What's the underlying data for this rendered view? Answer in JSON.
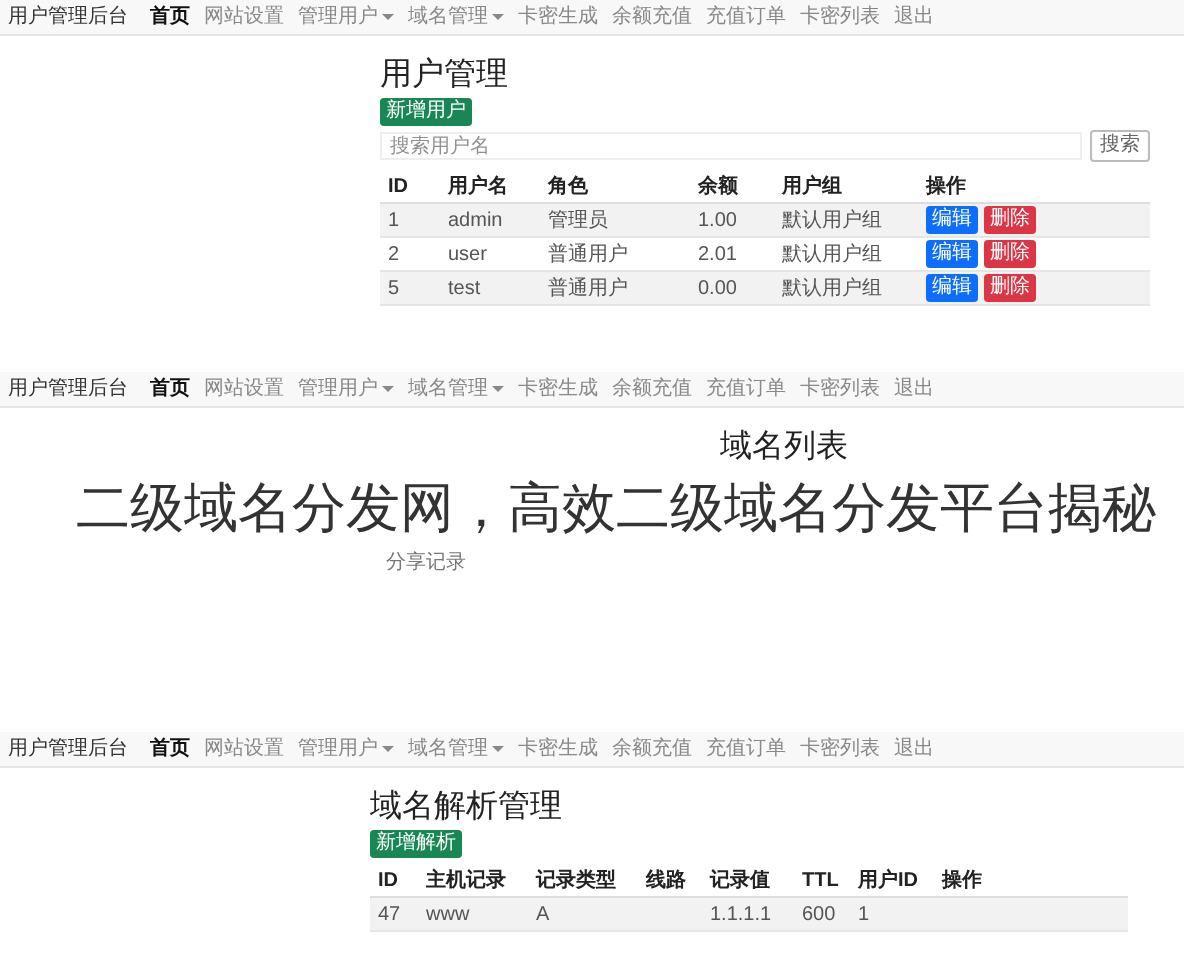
{
  "user_panel": {
    "navbar": {
      "brand": "用户管理后台",
      "items": [
        {
          "label": "首页",
          "selected": true,
          "dropdown": false
        },
        {
          "label": "网站设置",
          "selected": false,
          "dropdown": false
        },
        {
          "label": "管理用户",
          "selected": false,
          "dropdown": true
        },
        {
          "label": "域名管理",
          "selected": false,
          "dropdown": true
        },
        {
          "label": "卡密生成",
          "selected": false,
          "dropdown": false
        },
        {
          "label": "余额充值",
          "selected": false,
          "dropdown": false
        },
        {
          "label": "充值订单",
          "selected": false,
          "dropdown": false
        },
        {
          "label": "卡密列表",
          "selected": false,
          "dropdown": false
        },
        {
          "label": "退出",
          "selected": false,
          "dropdown": false
        }
      ]
    },
    "title": "用户管理",
    "add_button": "新增用户",
    "search": {
      "placeholder": "搜索用户名",
      "button": "搜索"
    },
    "table": {
      "columns": [
        "ID",
        "用户名",
        "角色",
        "余额",
        "用户组",
        "操作"
      ],
      "rows": [
        {
          "cells": [
            "1",
            "admin",
            "管理员",
            "1.00",
            "默认用户组"
          ],
          "actions": [
            {
              "kind": "edit",
              "label": "编辑"
            },
            {
              "kind": "delete",
              "label": "删除"
            }
          ]
        },
        {
          "cells": [
            "2",
            "user",
            "普通用户",
            "2.01",
            "默认用户组"
          ],
          "actions": [
            {
              "kind": "edit",
              "label": "编辑"
            },
            {
              "kind": "delete",
              "label": "删除"
            }
          ]
        },
        {
          "cells": [
            "5",
            "test",
            "普通用户",
            "0.00",
            "默认用户组"
          ],
          "actions": [
            {
              "kind": "edit",
              "label": "编辑"
            },
            {
              "kind": "delete",
              "label": "删除"
            }
          ]
        }
      ]
    }
  },
  "domain_list_panel": {
    "navbar": {
      "brand": "用户管理后台",
      "items": [
        {
          "label": "首页",
          "selected": true,
          "dropdown": false
        },
        {
          "label": "网站设置",
          "selected": false,
          "dropdown": false
        },
        {
          "label": "管理用户",
          "selected": false,
          "dropdown": true
        },
        {
          "label": "域名管理",
          "selected": false,
          "dropdown": true
        },
        {
          "label": "卡密生成",
          "selected": false,
          "dropdown": false
        },
        {
          "label": "余额充值",
          "selected": false,
          "dropdown": false
        },
        {
          "label": "充值订单",
          "selected": false,
          "dropdown": false
        },
        {
          "label": "卡密列表",
          "selected": false,
          "dropdown": false
        },
        {
          "label": "退出",
          "selected": false,
          "dropdown": false
        }
      ]
    },
    "title": "域名列表",
    "headline": "二级域名分发网，高效二级域名分发平台揭秘",
    "note": "分享记录"
  },
  "dns_panel": {
    "navbar": {
      "brand": "用户管理后台",
      "items": [
        {
          "label": "首页",
          "selected": true,
          "dropdown": false
        },
        {
          "label": "网站设置",
          "selected": false,
          "dropdown": false
        },
        {
          "label": "管理用户",
          "selected": false,
          "dropdown": true
        },
        {
          "label": "域名管理",
          "selected": false,
          "dropdown": true
        },
        {
          "label": "卡密生成",
          "selected": false,
          "dropdown": false
        },
        {
          "label": "余额充值",
          "selected": false,
          "dropdown": false
        },
        {
          "label": "充值订单",
          "selected": false,
          "dropdown": false
        },
        {
          "label": "卡密列表",
          "selected": false,
          "dropdown": false
        },
        {
          "label": "退出",
          "selected": false,
          "dropdown": false
        }
      ]
    },
    "title": "域名解析管理",
    "add_button": "新增解析",
    "table": {
      "columns": [
        "ID",
        "主机记录",
        "记录类型",
        "线路",
        "记录值",
        "TTL",
        "用户ID",
        "操作"
      ],
      "rows": [
        {
          "cells": [
            "47",
            "www",
            "A",
            "",
            "1.1.1.1",
            "600",
            "1",
            ""
          ],
          "actions": []
        }
      ]
    }
  }
}
